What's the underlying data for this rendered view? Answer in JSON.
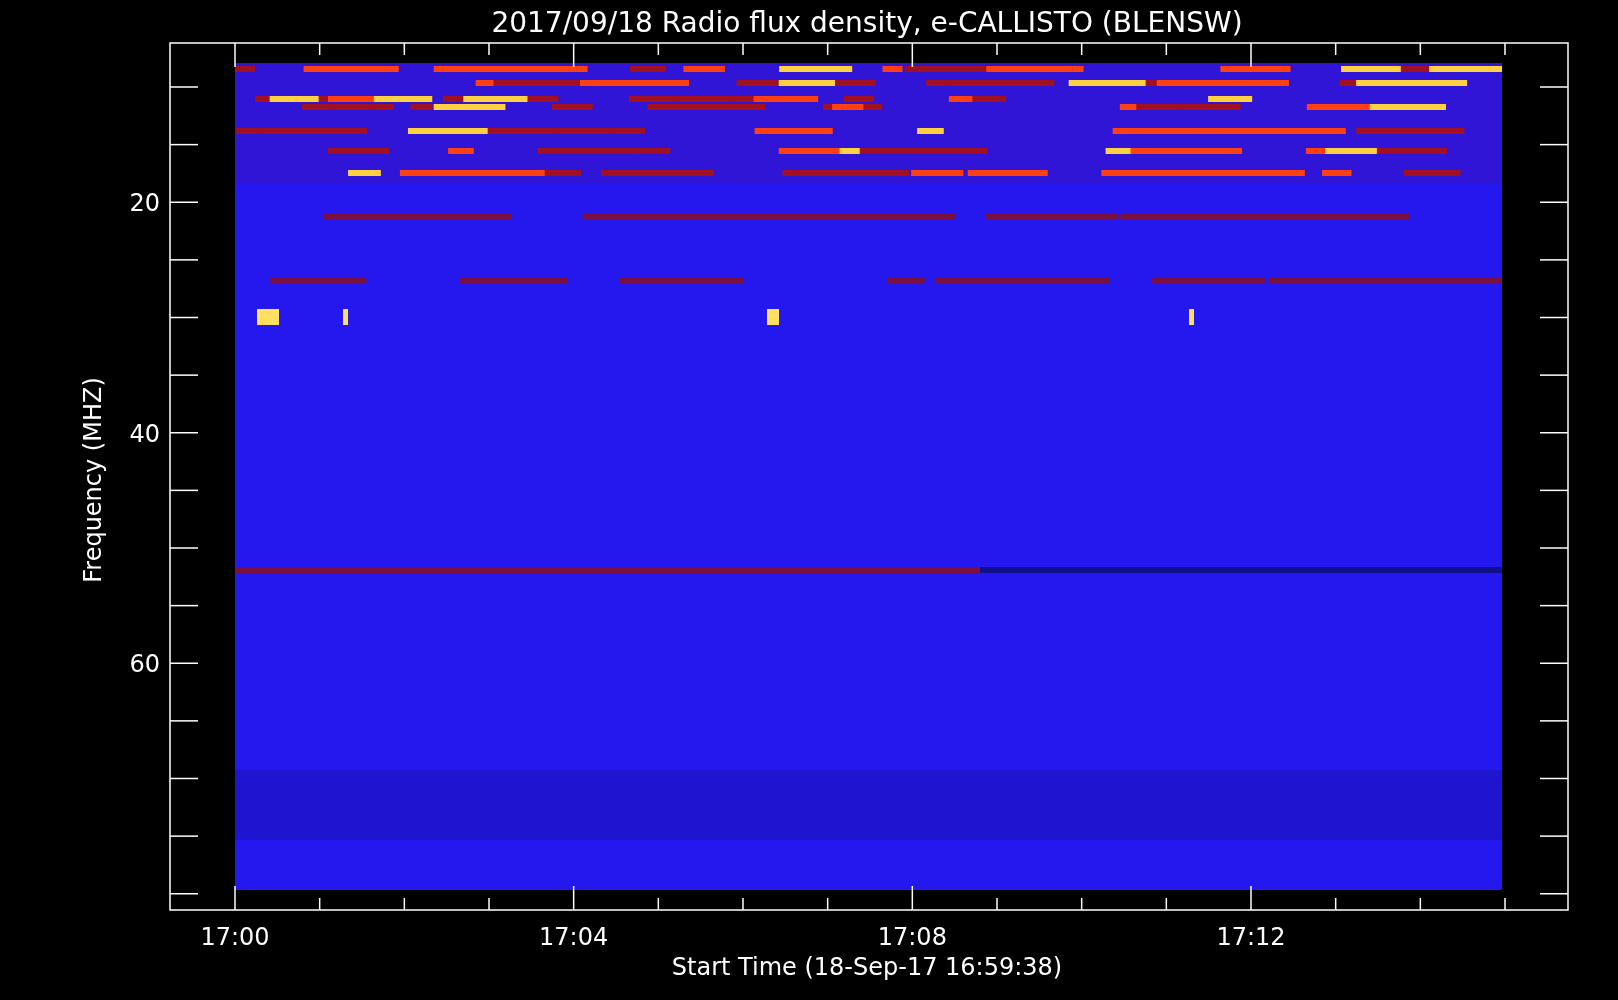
{
  "plot": {
    "title": "2017/09/18  Radio flux density, e-CALLISTO (BLENSW)",
    "xlabel": "Start Time (18-Sep-17 16:59:38)",
    "ylabel": "Frequency (MHZ)",
    "xticks": [
      {
        "label": "17:00"
      },
      {
        "label": "17:04"
      },
      {
        "label": "17:08"
      },
      {
        "label": "17:12"
      }
    ],
    "yticks": [
      {
        "label": "20"
      },
      {
        "label": "40"
      },
      {
        "label": "60"
      }
    ]
  }
}
